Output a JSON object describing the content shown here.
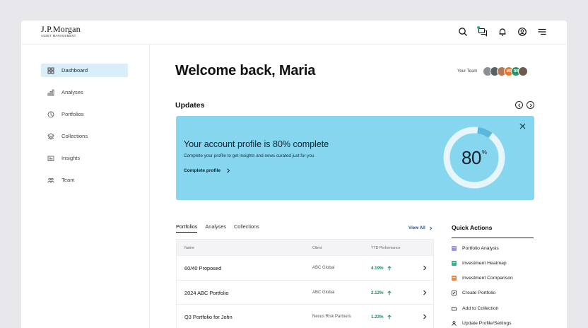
{
  "brand": {
    "name": "J.P.Morgan",
    "sub": "ASSET MANAGEMENT"
  },
  "topbar": {
    "icons": [
      "search-icon",
      "chat-icon",
      "bell-icon",
      "user-icon",
      "menu-icon"
    ]
  },
  "sidebar": {
    "items": [
      {
        "label": "Dashboard",
        "icon": "grid-icon",
        "active": true
      },
      {
        "label": "Analyses",
        "icon": "bar-chart-icon"
      },
      {
        "label": "Portfolios",
        "icon": "pie-chart-icon"
      },
      {
        "label": "Collections",
        "icon": "layers-icon"
      },
      {
        "label": "Insights",
        "icon": "newspaper-icon"
      },
      {
        "label": "Team",
        "icon": "people-icon"
      }
    ]
  },
  "main": {
    "welcome": "Welcome back, Maria",
    "team_label": "Your Team",
    "team_avatars": [
      {
        "initials": "",
        "color": "#8a8f96"
      },
      {
        "initials": "",
        "color": "#5a5f66"
      },
      {
        "initials": "",
        "color": "#b07a5a"
      },
      {
        "initials": "MS",
        "color": "#e8762e"
      },
      {
        "initials": "RB",
        "color": "#2a8f6a"
      },
      {
        "initials": "",
        "color": "#6c5a50"
      }
    ],
    "updates_title": "Updates"
  },
  "banner": {
    "title": "Your account profile is 80% complete",
    "subtitle": "Complete your profile to get insights and news curated just for you",
    "link": "Complete profile",
    "progress_value": "80",
    "progress_unit": "%",
    "progress_fraction": 0.8,
    "colors": {
      "background": "#86d6ef",
      "ring_track": "#e6f6fc",
      "ring_fill": "#5bb8dc"
    }
  },
  "portfolios": {
    "tabs": [
      {
        "label": "Portfolios",
        "active": true
      },
      {
        "label": "Analyses"
      },
      {
        "label": "Collections"
      }
    ],
    "view_all": "View All",
    "columns": [
      "Name",
      "Client",
      "YTD Performance"
    ],
    "rows": [
      {
        "name": "60/40 Proposed",
        "client": "ABC Global",
        "perf": "4.19%"
      },
      {
        "name": "2024 ABC Portfolio",
        "client": "ABC Global",
        "perf": "2.12%"
      },
      {
        "name": "Q3 Portfolio for John",
        "client": "Nexus Risk Partners",
        "perf": "1.23%"
      }
    ]
  },
  "quick_actions": {
    "title": "Quick Actions",
    "items": [
      {
        "label": "Portfolio Analysis",
        "icon": "purple-square-icon",
        "color": "#a58ce8"
      },
      {
        "label": "Investment Heatmap",
        "icon": "green-square-icon",
        "color": "#2bb78a"
      },
      {
        "label": "Investment Comparison",
        "icon": "orange-square-icon",
        "color": "#f0873e"
      },
      {
        "label": "Create Portfolio",
        "icon": "edit-icon"
      },
      {
        "label": "Add to Collection",
        "icon": "folder-icon"
      },
      {
        "label": "Update Profile/Settings",
        "icon": "user-icon"
      }
    ]
  }
}
